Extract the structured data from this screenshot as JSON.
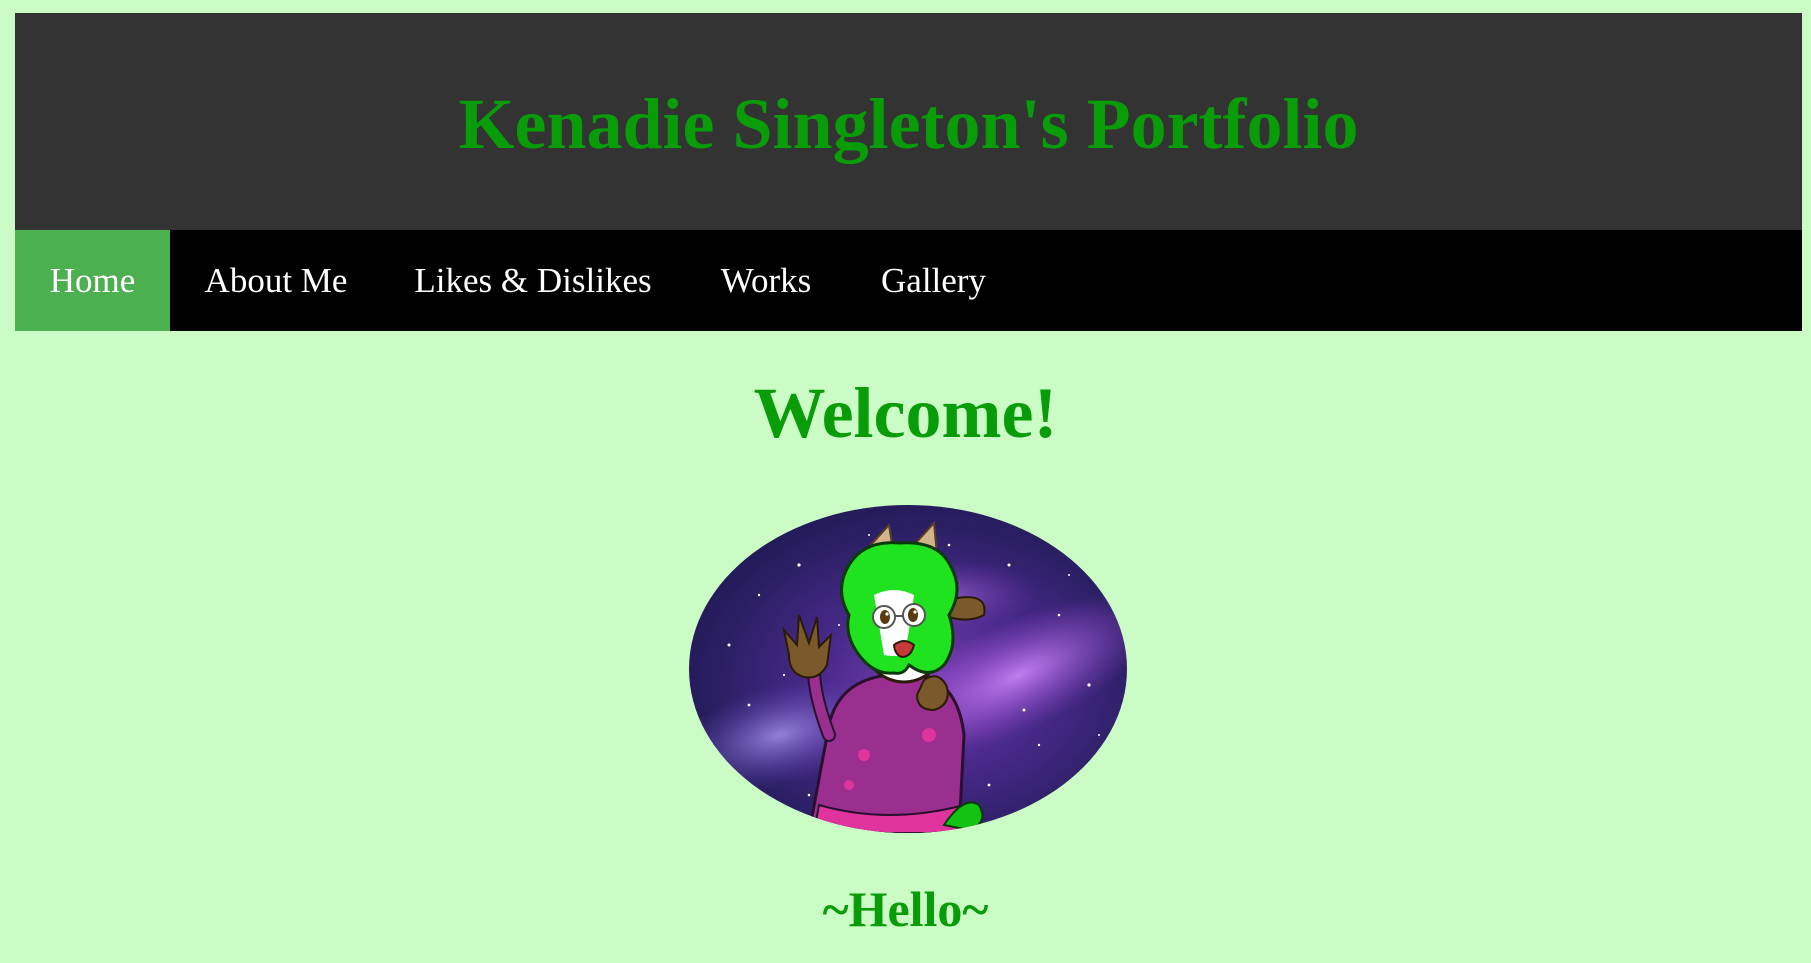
{
  "header": {
    "title": "Kenadie Singleton's Portfolio"
  },
  "nav": {
    "items": [
      {
        "label": "Home",
        "active": true
      },
      {
        "label": "About Me",
        "active": false
      },
      {
        "label": "Likes & Dislikes",
        "active": false
      },
      {
        "label": "Works",
        "active": false
      },
      {
        "label": "Gallery",
        "active": false
      }
    ]
  },
  "main": {
    "heading": "Welcome!",
    "subheading": "~Hello~",
    "avatar": {
      "subject": "dragon-character-with-green-hair-on-galaxy-background"
    }
  },
  "colors": {
    "page_background": "#ccfcc5",
    "header_background": "#333333",
    "nav_background": "#000000",
    "nav_active_background": "#4caf50",
    "accent_green": "#089c08",
    "nav_text": "#ffffff"
  }
}
